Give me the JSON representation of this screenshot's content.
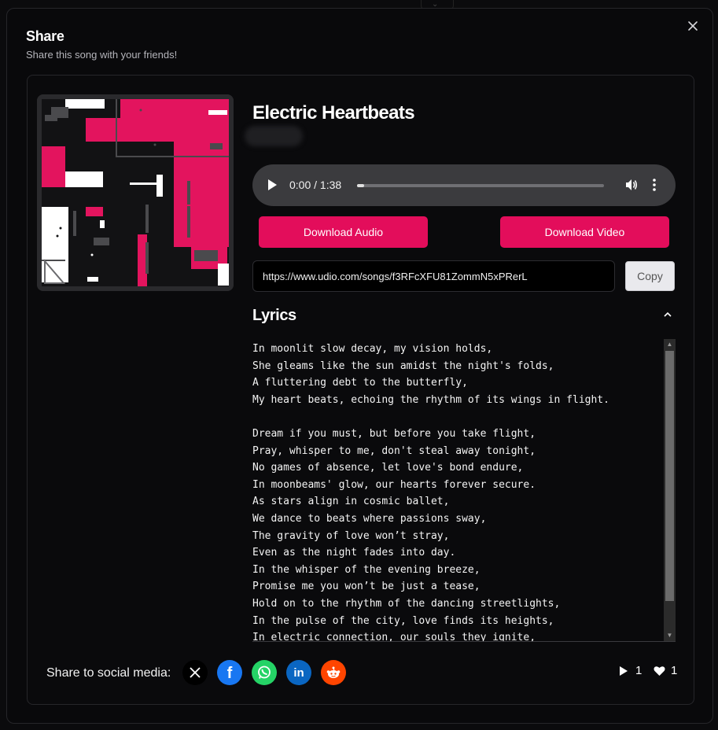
{
  "modal": {
    "title": "Share",
    "subtitle": "Share this song with your friends!",
    "close_icon": "close-icon"
  },
  "song": {
    "title": "Electric Heartbeats",
    "cover_colors": {
      "pink": "#e3145e",
      "dark": "#121214",
      "white": "#ffffff",
      "gray": "#2a2a2d"
    }
  },
  "player": {
    "time": "0:00 / 1:38",
    "progress": 0.0
  },
  "actions": {
    "download_audio": "Download Audio",
    "download_video": "Download Video",
    "url": "https://www.udio.com/songs/f3RFcXFU81ZommN5xPRerL",
    "copy": "Copy"
  },
  "lyrics": {
    "heading": "Lyrics",
    "text": "In moonlit slow decay, my vision holds,\nShe gleams like the sun amidst the night's folds,\nA fluttering debt to the butterfly,\nMy heart beats, echoing the rhythm of its wings in flight.\n\nDream if you must, but before you take flight,\nPray, whisper to me, don't steal away tonight,\nNo games of absence, let love's bond endure,\nIn moonbeams' glow, our hearts forever secure.\nAs stars align in cosmic ballet,\nWe dance to beats where passions sway,\nThe gravity of love won’t stray,\nEven as the night fades into day.\nIn the whisper of the evening breeze,\nPromise me you won’t be just a tease,\nHold on to the rhythm of the dancing streetlights,\nIn the pulse of the city, love finds its heights,\nIn electric connection, our souls they ignite,"
  },
  "social": {
    "label": "Share to social media:",
    "networks": [
      {
        "name": "x",
        "icon": "x-icon",
        "color": "#000000"
      },
      {
        "name": "facebook",
        "icon": "facebook-icon",
        "color": "#1877f2"
      },
      {
        "name": "whatsapp",
        "icon": "whatsapp-icon",
        "color": "#25d366"
      },
      {
        "name": "linkedin",
        "icon": "linkedin-icon",
        "color": "#0a66c2"
      },
      {
        "name": "reddit",
        "icon": "reddit-icon",
        "color": "#ff4500"
      }
    ]
  },
  "stats": {
    "plays": "1",
    "likes": "1"
  },
  "colors": {
    "accent": "#e30d5b",
    "background": "#09090b",
    "border": "#26262a"
  }
}
